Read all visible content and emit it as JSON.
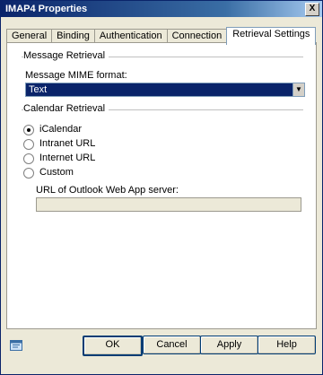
{
  "window": {
    "title": "IMAP4 Properties",
    "close_glyph": "X"
  },
  "tabs": [
    {
      "label": "General"
    },
    {
      "label": "Binding"
    },
    {
      "label": "Authentication"
    },
    {
      "label": "Connection"
    },
    {
      "label": "Retrieval Settings"
    }
  ],
  "message_retrieval": {
    "group_label": "Message Retrieval",
    "mime_label": "Message MIME format:",
    "mime_value": "Text"
  },
  "calendar_retrieval": {
    "group_label": "Calendar Retrieval",
    "options": [
      {
        "label": "iCalendar",
        "selected": true
      },
      {
        "label": "Intranet URL",
        "selected": false
      },
      {
        "label": "Internet URL",
        "selected": false
      },
      {
        "label": "Custom",
        "selected": false
      }
    ],
    "url_label": "URL of Outlook Web App server:",
    "url_value": ""
  },
  "buttons": {
    "ok": "OK",
    "cancel": "Cancel",
    "apply": "Apply",
    "help": "Help"
  },
  "icons": {
    "footer": "properties-help-icon",
    "select_arrow": "chevron-down-icon"
  }
}
